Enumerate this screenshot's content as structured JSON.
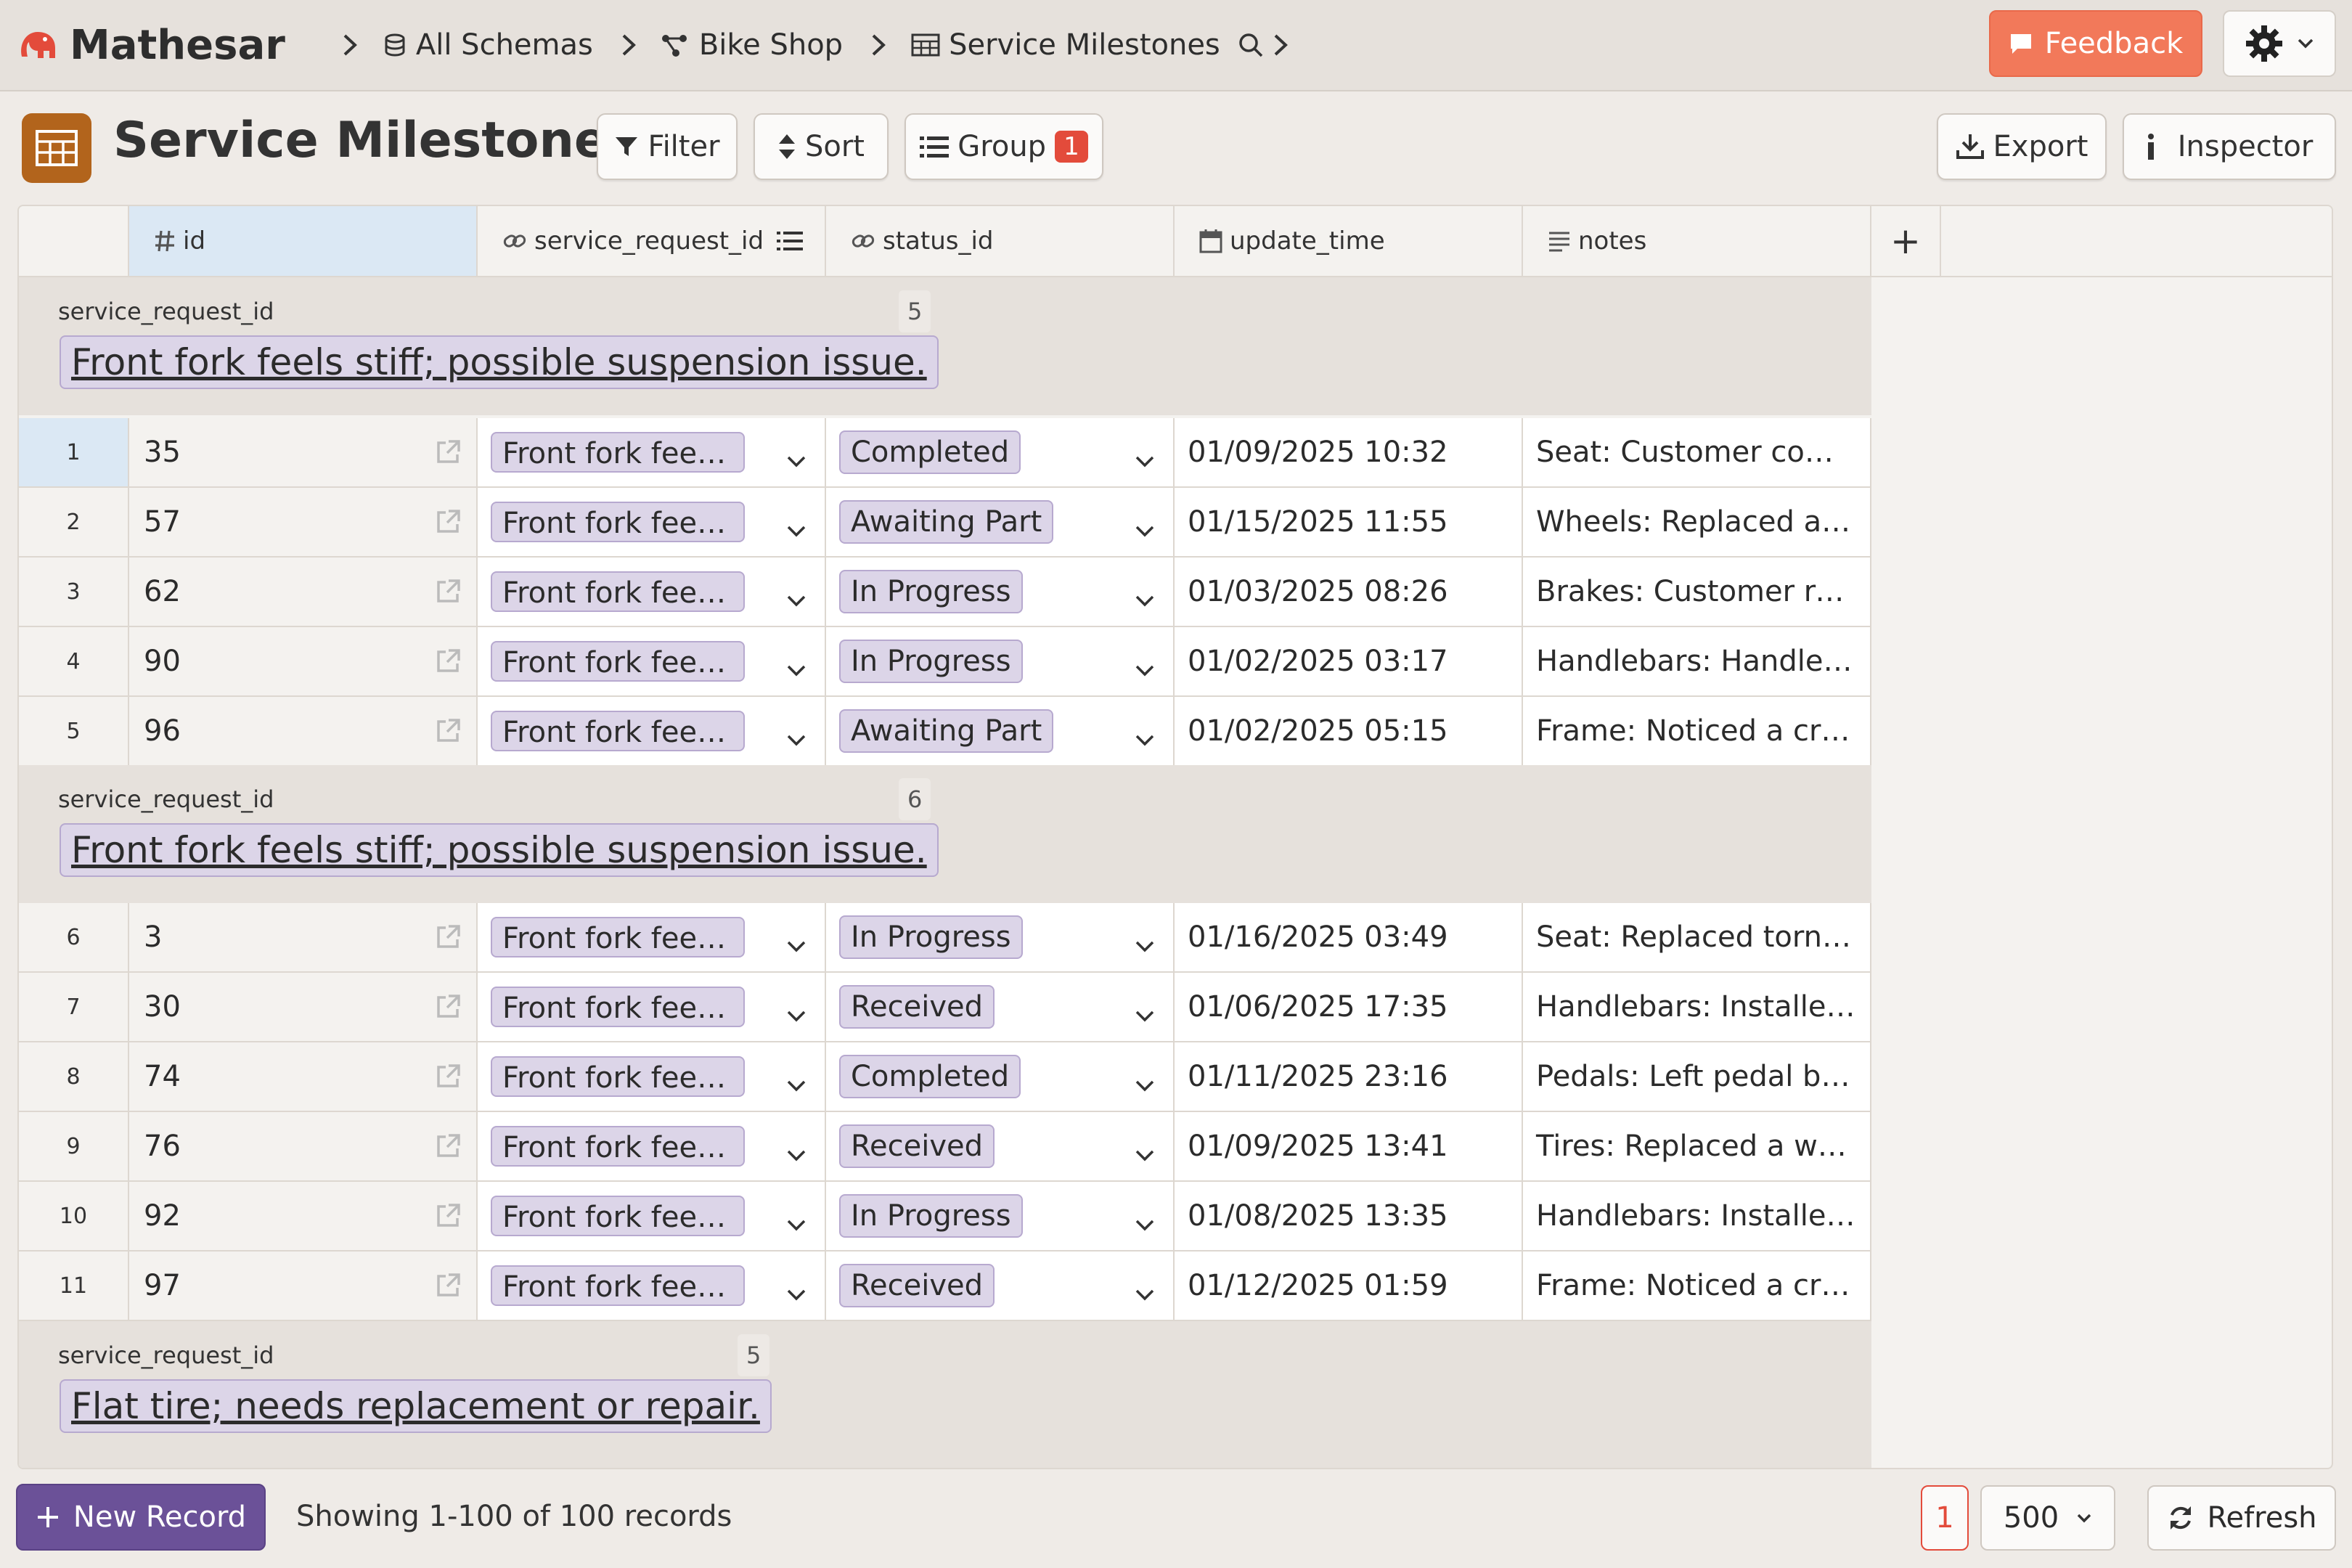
{
  "app": {
    "name": "Mathesar"
  },
  "breadcrumb": {
    "schemas": "All Schemas",
    "schema": "Bike Shop",
    "table": "Service Milestones"
  },
  "topbar": {
    "feedback": "Feedback"
  },
  "header": {
    "title": "Service Milestones",
    "filter": "Filter",
    "sort": "Sort",
    "group": "Group",
    "group_count": "1",
    "export": "Export",
    "inspector": "Inspector"
  },
  "columns": {
    "id": "id",
    "service_request_id": "service_request_id",
    "status_id": "status_id",
    "update_time": "update_time",
    "notes": "notes",
    "add": "+"
  },
  "groups": [
    {
      "label": "service_request_id",
      "count": "5",
      "value": "Front fork feels stiff; possible suspension issue."
    },
    {
      "label": "service_request_id",
      "count": "6",
      "value": "Front fork feels stiff; possible suspension issue."
    },
    {
      "label": "service_request_id",
      "count": "5",
      "value": "Flat tire; needs replacement or repair."
    }
  ],
  "rows": [
    {
      "num": "1",
      "id": "35",
      "sr": "Front fork feels stiff; possible suspension issue.",
      "status": "Completed",
      "time": "01/09/2025 10:32",
      "notes": "Seat: Customer complained about seat comfort."
    },
    {
      "num": "2",
      "id": "57",
      "sr": "Front fork feels stiff; possible suspension issue.",
      "status": "Awaiting Part",
      "time": "01/15/2025 11:55",
      "notes": "Wheels: Replaced a bent spoke."
    },
    {
      "num": "3",
      "id": "62",
      "sr": "Front fork feels stiff; possible suspension issue.",
      "status": "In Progress",
      "time": "01/03/2025 08:26",
      "notes": "Brakes: Customer reported squeaking."
    },
    {
      "num": "4",
      "id": "90",
      "sr": "Front fork feels stiff; possible suspension issue.",
      "status": "In Progress",
      "time": "01/02/2025 03:17",
      "notes": "Handlebars: Handlebar tape worn out."
    },
    {
      "num": "5",
      "id": "96",
      "sr": "Front fork feels stiff; possible suspension issue.",
      "status": "Awaiting Part",
      "time": "01/02/2025 05:15",
      "notes": "Frame: Noticed a crack near the weld."
    },
    {
      "num": "6",
      "id": "3",
      "sr": "Front fork feels stiff; possible suspension issue.",
      "status": "In Progress",
      "time": "01/16/2025 03:49",
      "notes": "Seat: Replaced torn seat cover."
    },
    {
      "num": "7",
      "id": "30",
      "sr": "Front fork feels stiff; possible suspension issue.",
      "status": "Received",
      "time": "01/06/2025 17:35",
      "notes": "Handlebars: Installed new grips."
    },
    {
      "num": "8",
      "id": "74",
      "sr": "Front fork feels stiff; possible suspension issue.",
      "status": "Completed",
      "time": "01/11/2025 23:16",
      "notes": "Pedals: Left pedal bearing loose."
    },
    {
      "num": "9",
      "id": "76",
      "sr": "Front fork feels stiff; possible suspension issue.",
      "status": "Received",
      "time": "01/09/2025 13:41",
      "notes": "Tires: Replaced a worn tire."
    },
    {
      "num": "10",
      "id": "92",
      "sr": "Front fork feels stiff; possible suspension issue.",
      "status": "In Progress",
      "time": "01/08/2025 13:35",
      "notes": "Handlebars: Installed new grips."
    },
    {
      "num": "11",
      "id": "97",
      "sr": "Front fork feels stiff; possible suspension issue.",
      "status": "Received",
      "time": "01/12/2025 01:59",
      "notes": "Frame: Noticed a crack near the weld."
    }
  ],
  "footer": {
    "new_record": "New Record",
    "showing": "Showing 1-100 of 100 records",
    "page": "1",
    "page_size": "500",
    "refresh": "Refresh"
  },
  "colors": {
    "accent": "#6b5198",
    "feedback": "#f2795a",
    "table_icon": "#b2641c",
    "badge": "#e34b3b",
    "pill_bg": "#dcd5e8"
  },
  "icons": {
    "logo": "elephant-icon",
    "schemas": "database-icon",
    "schema": "schema-icon",
    "table": "table-icon",
    "search": "search-icon",
    "settings": "gear-icon"
  }
}
